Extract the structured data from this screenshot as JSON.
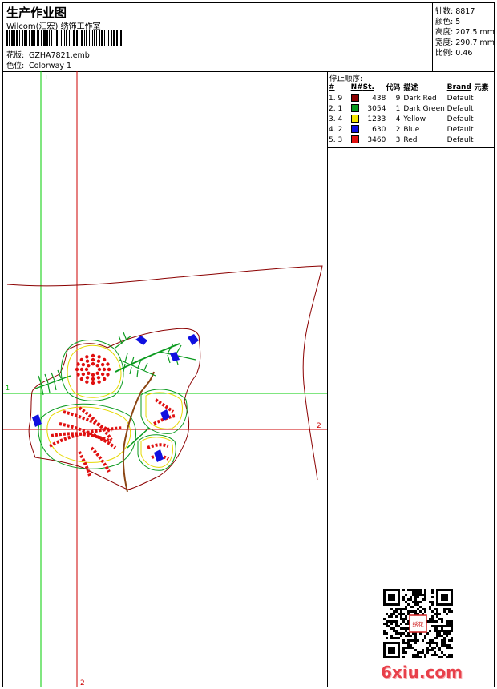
{
  "header": {
    "title": "生产作业图",
    "company": "Wilcom(汇宏) 绣饰工作室",
    "design_label": "花版:",
    "design_value": "GZHA7821.emb",
    "colorway_label": "色位:",
    "colorway_value": "Colorway 1"
  },
  "stats": {
    "stitches": "针数: 8817",
    "colors": "颜色: 5",
    "height": "高度: 207.5 mm",
    "width": "宽度: 290.7 mm",
    "scale": "比例: 0.46"
  },
  "sequence": {
    "title": "停止顺序:",
    "headers": [
      "#",
      "N#",
      "St.",
      "代码",
      "描述",
      "Brand",
      "元素"
    ],
    "rows": [
      {
        "num": "1. 9",
        "color": "#8b0000",
        "stitches": "438",
        "code": "9",
        "desc": "Dark Red",
        "brand": "Default"
      },
      {
        "num": "2. 1",
        "color": "#0a9a1e",
        "stitches": "3054",
        "code": "1",
        "desc": "Dark Green",
        "brand": "Default"
      },
      {
        "num": "3. 4",
        "color": "#f5e600",
        "stitches": "1233",
        "code": "4",
        "desc": "Yellow",
        "brand": "Default"
      },
      {
        "num": "4. 2",
        "color": "#1010e0",
        "stitches": "630",
        "code": "2",
        "desc": "Blue",
        "brand": "Default"
      },
      {
        "num": "5. 3",
        "color": "#e01010",
        "stitches": "3460",
        "code": "3",
        "desc": "Red",
        "brand": "Default"
      }
    ]
  },
  "canvas": {
    "guide_v1_label": "1",
    "guide_h1_label": "1",
    "guide_h2_label": "2",
    "guide_v2_label": "2",
    "guide_green": "#00cc00",
    "guide_red": "#cc0000"
  },
  "watermark": {
    "site": "6xiu.com",
    "seal_text": "绣花"
  }
}
